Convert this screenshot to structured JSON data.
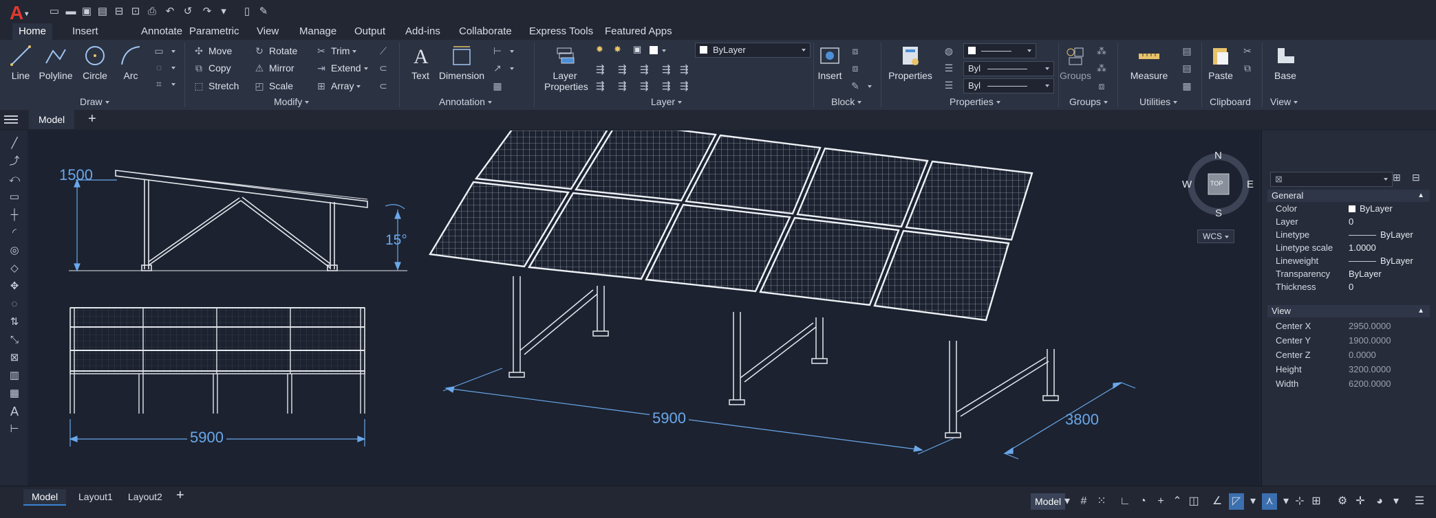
{
  "app": {
    "logo": "A"
  },
  "quick_access": [
    "new-icon",
    "open-icon",
    "save-icon",
    "save-as-icon",
    "open-web-icon",
    "save-web-icon",
    "plot-icon",
    "undo-icon",
    "undo-dropdown-icon",
    "redo-icon",
    "redo-dropdown-icon",
    "share-icon",
    "pen-icon"
  ],
  "tabs": [
    "Home",
    "Insert",
    "Annotate",
    "Parametric",
    "View",
    "Manage",
    "Output",
    "Add-ins",
    "Collaborate",
    "Express Tools",
    "Featured Apps"
  ],
  "active_tab": "Home",
  "ribbon": {
    "draw": {
      "label": "Draw",
      "buttons": [
        "Line",
        "Polyline",
        "Circle",
        "Arc"
      ]
    },
    "modify": {
      "label": "Modify",
      "items": [
        "Move",
        "Rotate",
        "Trim",
        "Copy",
        "Mirror",
        "Extend",
        "Stretch",
        "Scale",
        "Array"
      ]
    },
    "annotation": {
      "label": "Annotation",
      "buttons": [
        "Text",
        "Dimension"
      ]
    },
    "layer": {
      "label": "Layer",
      "layer_properties": "Layer Properties",
      "layer_combo": "ByLayer"
    },
    "block": {
      "label": "Block",
      "insert": "Insert"
    },
    "properties": {
      "label": "Properties",
      "button": "Properties",
      "row2": "Byl",
      "row3": "Byl"
    },
    "groups": {
      "label": "Groups",
      "button": "Groups"
    },
    "utilities": {
      "label": "Utilities",
      "button": "Measure"
    },
    "clipboard": {
      "label": "Clipboard",
      "button": "Paste"
    },
    "view": {
      "label": "View",
      "button": "Base"
    }
  },
  "file_tabs": {
    "active": "Model"
  },
  "drawing": {
    "side_height": "1500",
    "side_angle": "15°",
    "front_width": "5900",
    "iso_length": "5900",
    "iso_depth": "3800"
  },
  "viewcube": {
    "n": "N",
    "s": "S",
    "e": "E",
    "w": "W",
    "face": "TOP",
    "wcs": "WCS"
  },
  "properties_palette": {
    "general_title": "General",
    "general": [
      {
        "k": "Color",
        "v": "ByLayer"
      },
      {
        "k": "Layer",
        "v": "0"
      },
      {
        "k": "Linetype",
        "v": "ByLayer"
      },
      {
        "k": "Linetype scale",
        "v": "1.0000"
      },
      {
        "k": "Lineweight",
        "v": "ByLayer"
      },
      {
        "k": "Transparency",
        "v": "ByLayer"
      },
      {
        "k": "Thickness",
        "v": "0"
      }
    ],
    "view_title": "View",
    "view": [
      {
        "k": "Center X",
        "v": "2950.0000"
      },
      {
        "k": "Center Y",
        "v": "1900.0000"
      },
      {
        "k": "Center Z",
        "v": "0.0000"
      },
      {
        "k": "Height",
        "v": "3200.0000"
      },
      {
        "k": "Width",
        "v": "6200.0000"
      }
    ]
  },
  "layout_tabs": [
    "Model",
    "Layout1",
    "Layout2"
  ],
  "status_bar": {
    "model": "Model"
  },
  "colors": {
    "accent": "#3b82d6",
    "dimension": "#6aa8ea",
    "logo": "#e03a2f"
  }
}
